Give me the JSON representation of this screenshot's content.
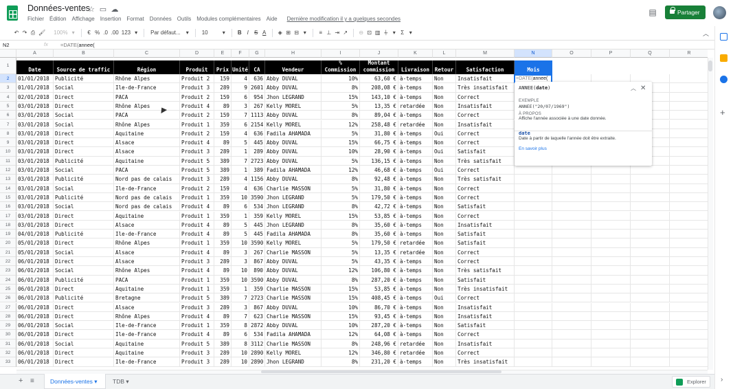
{
  "app": {
    "title": "Données-ventes",
    "menus": [
      "Fichier",
      "Édition",
      "Affichage",
      "Insertion",
      "Format",
      "Données",
      "Outils",
      "Modules complémentaires",
      "Aide"
    ],
    "last_edit": "Dernière modification il y a quelques secondes",
    "share_label": "Partager",
    "colors": {
      "brand_green": "#188038",
      "accent_blue": "#1a73e8",
      "header_black": "#000000"
    }
  },
  "toolbar": {
    "zoom": "100%",
    "currency": "€",
    "percent": "%",
    "dec_less": ".0",
    "dec_more": ".00",
    "format_more": "123",
    "font": "Par défaut...",
    "font_size": "10",
    "bold": "B",
    "italic": "I",
    "strike": "S",
    "text_color": "A"
  },
  "formula_bar": {
    "name_box": "N2",
    "fx": "fx",
    "formula_fn": "=DATE(",
    "formula_arg": "annee("
  },
  "columns": [
    "A",
    "B",
    "C",
    "D",
    "E",
    "F",
    "G",
    "H",
    "I",
    "J",
    "K",
    "L",
    "M",
    "N",
    "O",
    "P",
    "Q",
    "R"
  ],
  "row_numbers": [
    "1",
    "2",
    "3",
    "4",
    "5",
    "6",
    "7",
    "8",
    "9",
    "10",
    "11",
    "12",
    "13",
    "14",
    "15",
    "16",
    "17",
    "18",
    "19",
    "20",
    "21",
    "22",
    "23",
    "24",
    "25",
    "26",
    "27",
    "28",
    "29",
    "30",
    "31",
    "32",
    "33"
  ],
  "headers": [
    [
      "Date"
    ],
    [
      "Source de traffic"
    ],
    [
      "Région"
    ],
    [
      "Produit"
    ],
    [
      "Prix"
    ],
    [
      "Unité"
    ],
    [
      "CA"
    ],
    [
      "Vendeur"
    ],
    [
      "%",
      "Commission"
    ],
    [
      "Montant",
      "commission"
    ],
    [
      "Livraison"
    ],
    [
      "Retour"
    ],
    [
      "Satisfaction"
    ],
    [
      "Mois"
    ]
  ],
  "rows": [
    [
      "01/01/2018",
      "Publicité",
      "Rhône Alpes",
      "Produit 2",
      "159",
      "4",
      "636",
      "Abby DUVAL",
      "10%",
      "63,60 €",
      "à-temps",
      "Non",
      "Insatisfait"
    ],
    [
      "01/01/2018",
      "Social",
      "Ile-de-France",
      "Produit 3",
      "289",
      "9",
      "2601",
      "Abby DUVAL",
      "8%",
      "208,08 €",
      "à-temps",
      "Non",
      "Très insatisfait"
    ],
    [
      "02/01/2018",
      "Direct",
      "PACA",
      "Produit 2",
      "159",
      "6",
      "954",
      "Jhon LEGRAND",
      "15%",
      "143,10 €",
      "à-temps",
      "Non",
      "Correct"
    ],
    [
      "03/01/2018",
      "Direct",
      "Rhône Alpes",
      "Produit 4",
      "89",
      "3",
      "267",
      "Kelly MOREL",
      "5%",
      "13,35 €",
      "retardée",
      "Non",
      "Insatisfait"
    ],
    [
      "03/01/2018",
      "Social",
      "PACA",
      "Produit 2",
      "159",
      "7",
      "1113",
      "Abby DUVAL",
      "8%",
      "89,04 €",
      "à-temps",
      "Non",
      "Correct"
    ],
    [
      "03/01/2018",
      "Social",
      "Rhône Alpes",
      "Produit 1",
      "359",
      "6",
      "2154",
      "Kelly MOREL",
      "12%",
      "258,48 €",
      "retardée",
      "Non",
      "Insatisfait"
    ],
    [
      "03/01/2018",
      "Direct",
      "Aquitaine",
      "Produit 2",
      "159",
      "4",
      "636",
      "Fadila AHAMADA",
      "5%",
      "31,80 €",
      "à-temps",
      "Oui",
      "Correct"
    ],
    [
      "03/01/2018",
      "Direct",
      "Alsace",
      "Produit 4",
      "89",
      "5",
      "445",
      "Abby DUVAL",
      "15%",
      "66,75 €",
      "à-temps",
      "Non",
      "Correct"
    ],
    [
      "03/01/2018",
      "Direct",
      "Alsace",
      "Produit 3",
      "289",
      "1",
      "289",
      "Abby DUVAL",
      "10%",
      "28,90 €",
      "à-temps",
      "Oui",
      "Satisfait"
    ],
    [
      "03/01/2018",
      "Publicité",
      "Aquitaine",
      "Produit 5",
      "389",
      "7",
      "2723",
      "Abby DUVAL",
      "5%",
      "136,15 €",
      "à-temps",
      "Non",
      "Très satisfait"
    ],
    [
      "03/01/2018",
      "Social",
      "PACA",
      "Produit 5",
      "389",
      "1",
      "389",
      "Fadila AHAMADA",
      "12%",
      "46,68 €",
      "à-temps",
      "Oui",
      "Correct"
    ],
    [
      "03/01/2018",
      "Publicité",
      "Nord pas de calais",
      "Produit 3",
      "289",
      "4",
      "1156",
      "Abby DUVAL",
      "8%",
      "92,48 €",
      "à-temps",
      "Non",
      "Très satisfait"
    ],
    [
      "03/01/2018",
      "Social",
      "Ile-de-France",
      "Produit 2",
      "159",
      "4",
      "636",
      "Charlie MASSON",
      "5%",
      "31,80 €",
      "à-temps",
      "Non",
      "Correct"
    ],
    [
      "03/01/2018",
      "Publicité",
      "Nord pas de calais",
      "Produit 1",
      "359",
      "10",
      "3590",
      "Jhon LEGRAND",
      "5%",
      "179,50 €",
      "à-temps",
      "Non",
      "Correct"
    ],
    [
      "03/01/2018",
      "Social",
      "Nord pas de calais",
      "Produit 4",
      "89",
      "6",
      "534",
      "Jhon LEGRAND",
      "8%",
      "42,72 €",
      "à-temps",
      "Non",
      "Satisfait"
    ],
    [
      "03/01/2018",
      "Direct",
      "Aquitaine",
      "Produit 1",
      "359",
      "1",
      "359",
      "Kelly MOREL",
      "15%",
      "53,85 €",
      "à-temps",
      "Non",
      "Correct"
    ],
    [
      "03/01/2018",
      "Direct",
      "Alsace",
      "Produit 4",
      "89",
      "5",
      "445",
      "Jhon LEGRAND",
      "8%",
      "35,60 €",
      "à-temps",
      "Non",
      "Insatisfait"
    ],
    [
      "04/01/2018",
      "Publicité",
      "Ile-de-France",
      "Produit 4",
      "89",
      "5",
      "445",
      "Fadila AHAMADA",
      "8%",
      "35,60 €",
      "à-temps",
      "Non",
      "Satisfait"
    ],
    [
      "05/01/2018",
      "Direct",
      "Rhône Alpes",
      "Produit 1",
      "359",
      "10",
      "3590",
      "Kelly MOREL",
      "5%",
      "179,50 €",
      "retardée",
      "Non",
      "Satisfait"
    ],
    [
      "05/01/2018",
      "Social",
      "Alsace",
      "Produit 4",
      "89",
      "3",
      "267",
      "Charlie MASSON",
      "5%",
      "13,35 €",
      "retardée",
      "Non",
      "Correct"
    ],
    [
      "06/01/2018",
      "Direct",
      "Alsace",
      "Produit 3",
      "289",
      "3",
      "867",
      "Abby DUVAL",
      "5%",
      "43,35 €",
      "à-temps",
      "Non",
      "Correct"
    ],
    [
      "06/01/2018",
      "Social",
      "Rhône Alpes",
      "Produit 4",
      "89",
      "10",
      "890",
      "Abby DUVAL",
      "12%",
      "106,80 €",
      "à-temps",
      "Non",
      "Très satisfait"
    ],
    [
      "06/01/2018",
      "Publicité",
      "PACA",
      "Produit 1",
      "359",
      "10",
      "3590",
      "Abby DUVAL",
      "8%",
      "287,20 €",
      "à-temps",
      "Non",
      "Satisfait"
    ],
    [
      "06/01/2018",
      "Direct",
      "Aquitaine",
      "Produit 1",
      "359",
      "1",
      "359",
      "Charlie MASSON",
      "15%",
      "53,85 €",
      "à-temps",
      "Non",
      "Très insatisfait"
    ],
    [
      "06/01/2018",
      "Publicité",
      "Bretagne",
      "Produit 5",
      "389",
      "7",
      "2723",
      "Charlie MASSON",
      "15%",
      "408,45 €",
      "à-temps",
      "Oui",
      "Correct"
    ],
    [
      "06/01/2018",
      "Direct",
      "Alsace",
      "Produit 3",
      "289",
      "3",
      "867",
      "Abby DUVAL",
      "10%",
      "86,70 €",
      "à-temps",
      "Non",
      "Insatisfait"
    ],
    [
      "06/01/2018",
      "Direct",
      "Rhône Alpes",
      "Produit 4",
      "89",
      "7",
      "623",
      "Charlie MASSON",
      "15%",
      "93,45 €",
      "à-temps",
      "Non",
      "Insatisfait"
    ],
    [
      "06/01/2018",
      "Social",
      "Ile-de-France",
      "Produit 1",
      "359",
      "8",
      "2872",
      "Abby DUVAL",
      "10%",
      "287,20 €",
      "à-temps",
      "Non",
      "Satisfait"
    ],
    [
      "06/01/2018",
      "Direct",
      "Ile-de-France",
      "Produit 4",
      "89",
      "6",
      "534",
      "Fadila AHAMADA",
      "12%",
      "64,08 €",
      "à-temps",
      "Non",
      "Correct"
    ],
    [
      "06/01/2018",
      "Social",
      "Aquitaine",
      "Produit 5",
      "389",
      "8",
      "3112",
      "Charlie MASSON",
      "8%",
      "248,96 €",
      "retardée",
      "Non",
      "Insatisfait"
    ],
    [
      "06/01/2018",
      "Direct",
      "Aquitaine",
      "Produit 3",
      "289",
      "10",
      "2890",
      "Kelly MOREL",
      "12%",
      "346,80 €",
      "retardée",
      "Non",
      "Correct"
    ],
    [
      "06/01/2018",
      "Direct",
      "Ile-de-France",
      "Produit 3",
      "289",
      "10",
      "2890",
      "Jhon LEGRAND",
      "8%",
      "231,20 €",
      "à-temps",
      "Non",
      "Très insatisfait"
    ]
  ],
  "active_cell": {
    "fn": "=DATE(",
    "arg": "annee("
  },
  "tooltip": {
    "signature_fn": "ANNEE(",
    "signature_arg": "date",
    "signature_end": ")",
    "example_label": "EXEMPLE",
    "example_code": "ANNEE(\"20/07/1969\")",
    "about_label": "À PROPOS",
    "about_text": "Affiche l'année associée à une date donnée.",
    "arg_name": "date",
    "arg_desc": "Date à partir de laquelle l'année doit être extraite.",
    "learn_more": "En savoir plus"
  },
  "sheets": {
    "active": "Données-ventes",
    "other": "TDB",
    "explore": "Explorer"
  }
}
